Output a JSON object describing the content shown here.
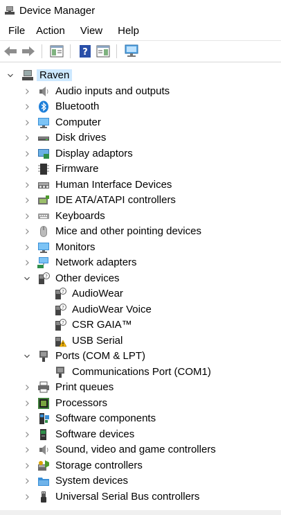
{
  "window": {
    "title": "Device Manager"
  },
  "menu": [
    "File",
    "Action",
    "View",
    "Help"
  ],
  "toolbar": [
    {
      "name": "back-icon"
    },
    {
      "name": "forward-icon"
    },
    {
      "name": "properties-icon"
    },
    {
      "name": "help-icon"
    },
    {
      "name": "show-hide-console-tree-icon"
    },
    {
      "name": "scan-hardware-icon"
    }
  ],
  "tree": {
    "root": "Raven",
    "items": [
      {
        "label": "Audio inputs and outputs",
        "icon": "speaker-icon",
        "expanded": false
      },
      {
        "label": "Bluetooth",
        "icon": "bluetooth-icon",
        "expanded": false
      },
      {
        "label": "Computer",
        "icon": "monitor-icon",
        "expanded": false
      },
      {
        "label": "Disk drives",
        "icon": "disk-drive-icon",
        "expanded": false
      },
      {
        "label": "Display adaptors",
        "icon": "display-adapter-icon",
        "expanded": false
      },
      {
        "label": "Firmware",
        "icon": "chip-icon",
        "expanded": false
      },
      {
        "label": "Human Interface Devices",
        "icon": "hid-icon",
        "expanded": false
      },
      {
        "label": "IDE ATA/ATAPI controllers",
        "icon": "ide-controller-icon",
        "expanded": false
      },
      {
        "label": "Keyboards",
        "icon": "keyboard-icon",
        "expanded": false
      },
      {
        "label": "Mice and other pointing devices",
        "icon": "mouse-icon",
        "expanded": false
      },
      {
        "label": "Monitors",
        "icon": "monitor-icon",
        "expanded": false
      },
      {
        "label": "Network adapters",
        "icon": "network-icon",
        "expanded": false
      },
      {
        "label": "Other devices",
        "icon": "unknown-device-icon",
        "expanded": true,
        "children": [
          {
            "label": "AudioWear",
            "icon": "unknown-device-icon"
          },
          {
            "label": "AudioWear Voice",
            "icon": "unknown-device-icon"
          },
          {
            "label": "CSR GAIA™",
            "icon": "unknown-device-icon"
          },
          {
            "label": "USB Serial",
            "icon": "warning-device-icon"
          }
        ]
      },
      {
        "label": "Ports (COM & LPT)",
        "icon": "port-icon",
        "expanded": true,
        "children": [
          {
            "label": "Communications Port (COM1)",
            "icon": "port-icon"
          }
        ]
      },
      {
        "label": "Print queues",
        "icon": "printer-icon",
        "expanded": false
      },
      {
        "label": "Processors",
        "icon": "processor-icon",
        "expanded": false
      },
      {
        "label": "Software components",
        "icon": "software-component-icon",
        "expanded": false
      },
      {
        "label": "Software devices",
        "icon": "software-device-icon",
        "expanded": false
      },
      {
        "label": "Sound, video and game controllers",
        "icon": "speaker-icon",
        "expanded": false
      },
      {
        "label": "Storage controllers",
        "icon": "storage-icon",
        "expanded": false
      },
      {
        "label": "System devices",
        "icon": "folder-icon",
        "expanded": false
      },
      {
        "label": "Universal Serial Bus controllers",
        "icon": "usb-icon",
        "expanded": false
      }
    ]
  },
  "colors": {
    "selection": "#cce8ff",
    "chevron": "#8a8a8a",
    "accent": "#1e88e5",
    "warning": "#f5b400"
  }
}
